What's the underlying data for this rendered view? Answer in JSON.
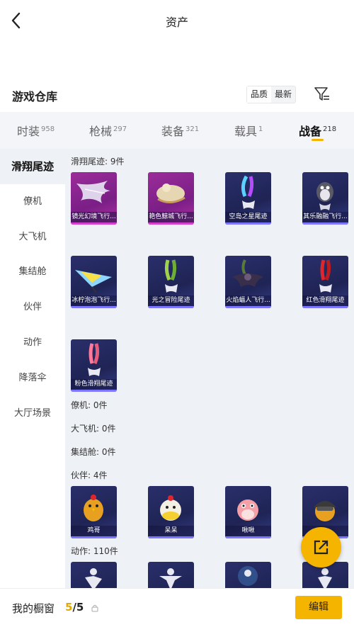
{
  "header": {
    "title": "资产",
    "back_icon": "chevron-left-icon"
  },
  "warehouse": {
    "title": "游戏仓库",
    "sort_options": [
      "品质",
      "最新"
    ],
    "active_sort": "品质",
    "filter_icon": "filter-icon"
  },
  "tabs": [
    {
      "label": "时装",
      "count": "958"
    },
    {
      "label": "枪械",
      "count": "297"
    },
    {
      "label": "装备",
      "count": "321"
    },
    {
      "label": "载具",
      "count": "1"
    },
    {
      "label": "战备",
      "count": "218",
      "active": true
    }
  ],
  "sidebar": {
    "items": [
      "滑翔尾迹",
      "僚机",
      "大飞机",
      "集结舱",
      "伙伴",
      "动作",
      "降落伞",
      "大厅场景"
    ],
    "active": "滑翔尾迹"
  },
  "categories": {
    "trail": {
      "header": "滑翔尾迹: 9件",
      "items": [
        "镜光幻境飞行...",
        "艳色鲸城飞行...",
        "空岛之星尾迹",
        "其乐融融飞行...",
        "冰柠泡泡飞行...",
        "光之冒险尾迹",
        "火焰蝠人飞行...",
        "红色滑翔尾迹",
        "粉色滑翔尾迹"
      ]
    },
    "wingman": {
      "header": "僚机: 0件"
    },
    "plane": {
      "header": "大飞机: 0件"
    },
    "pod": {
      "header": "集结舱: 0件"
    },
    "partner": {
      "header": "伙伴: 4件",
      "items": [
        "鸡哥",
        "呆呆",
        "啾啾",
        ""
      ]
    },
    "emote": {
      "header": "动作: 110件"
    }
  },
  "bottom": {
    "label": "我的橱窗",
    "current": "5",
    "separator": "/",
    "max": "5",
    "edit_label": "编辑"
  },
  "colors": {
    "accent": "#f5b400",
    "rare_pink": "#9c2c9a",
    "rare_blue": "#2a2f6b"
  }
}
